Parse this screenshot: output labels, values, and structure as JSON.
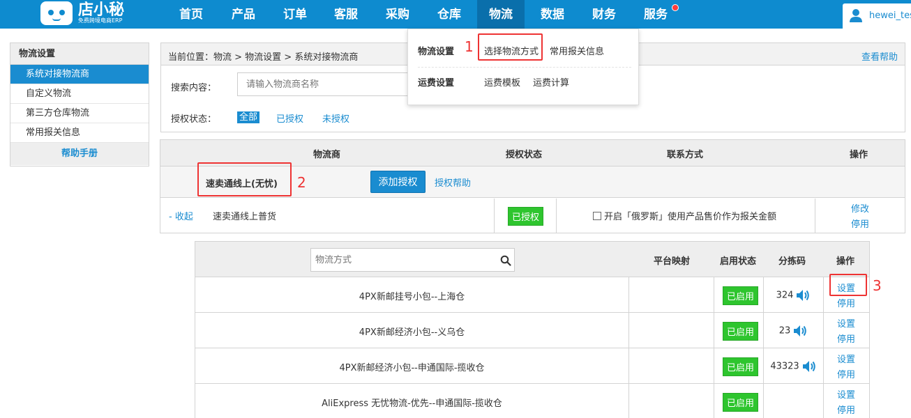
{
  "logo": {
    "name": "店小秘",
    "subtitle": "免费跨境电商ERP"
  },
  "nav": {
    "items": [
      "首页",
      "产品",
      "订单",
      "客服",
      "采购",
      "仓库",
      "物流",
      "数据",
      "财务",
      "服务"
    ],
    "active_index": 6,
    "user": "hewei_tes"
  },
  "sidebar": {
    "title": "物流设置",
    "items": [
      "系统对接物流商",
      "自定义物流",
      "第三方仓库物流",
      "常用报关信息"
    ],
    "active_index": 0,
    "help": "帮助手册"
  },
  "breadcrumb": {
    "label": "当前位置：",
    "path": "物流 > 物流设置 > 系统对接物流商",
    "help": "查看帮助"
  },
  "search": {
    "label": "搜索内容：",
    "placeholder": "请输入物流商名称"
  },
  "auth_filter": {
    "label": "授权状态：",
    "options": [
      "全部",
      "已授权",
      "未授权"
    ],
    "selected": "全部"
  },
  "dropdown": {
    "group1": {
      "title": "物流设置",
      "items": [
        "选择物流方式",
        "常用报关信息"
      ]
    },
    "group2": {
      "title": "运费设置",
      "items": [
        "运费模板",
        "运费计算"
      ]
    }
  },
  "provider_table": {
    "headers": [
      "物流商",
      "授权状态",
      "联系方式",
      "操作"
    ],
    "provider": "速卖通线上(无忧)",
    "add_button": "添加授权",
    "auth_help": "授权帮助",
    "account": {
      "collapse": "- 收起",
      "name": "速卖通线上普货",
      "status": "已授权",
      "option": "开启「俄罗斯」使用产品售价作为报关金额",
      "edit": "修改",
      "disable": "停用"
    }
  },
  "method_table": {
    "search_placeholder": "物流方式",
    "headers": [
      "平台映射",
      "启用状态",
      "分拣码",
      "操作"
    ],
    "rows": [
      {
        "name": "4PX新邮挂号小包--上海仓",
        "status": "已启用",
        "code": "324",
        "set": "设置",
        "stop": "停用"
      },
      {
        "name": "4PX新邮经济小包--义乌仓",
        "status": "已启用",
        "code": "23",
        "set": "设置",
        "stop": "停用"
      },
      {
        "name": "4PX新邮经济小包--申通国际-揽收仓",
        "status": "已启用",
        "code": "43323",
        "set": "设置",
        "stop": "停用"
      },
      {
        "name": "AliExpress 无忧物流-优先--申通国际-揽收仓",
        "status": "已启用",
        "code": "",
        "set": "设置",
        "stop": "停用"
      }
    ]
  },
  "annotations": [
    "1",
    "2",
    "3"
  ],
  "colors": {
    "primary": "#1a8cd0",
    "nav": "#0e8bcf",
    "nav_active": "#0a6fab",
    "enabled": "#2ec52e",
    "annotation": "#ee3333"
  }
}
